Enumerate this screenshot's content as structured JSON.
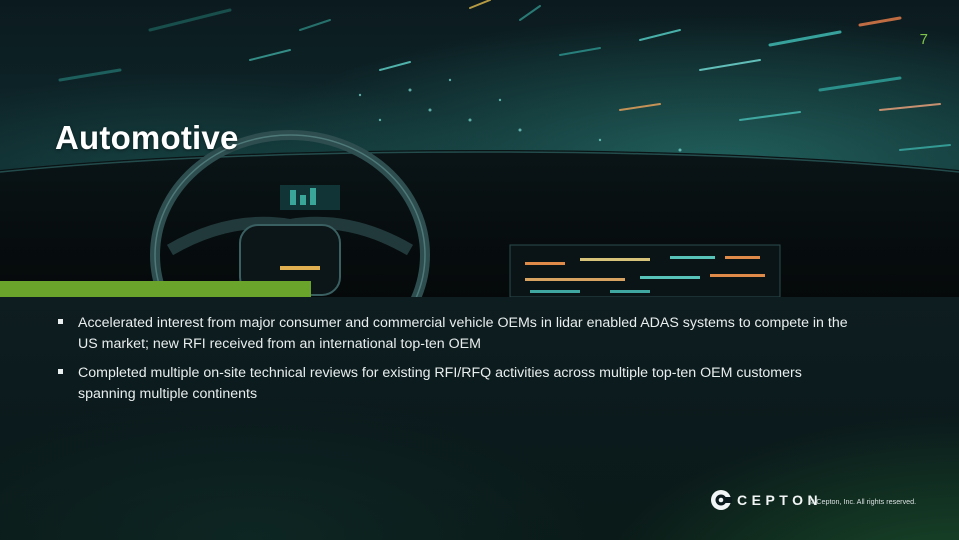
{
  "slide": {
    "page_number": "7",
    "title": "Automotive",
    "bullets": [
      "Accelerated interest from major consumer and commercial vehicle OEMs in lidar enabled ADAS systems to compete in the US market; new RFI received from an international top-ten OEM",
      "Completed multiple on-site technical reviews for existing RFI/RFQ activities across multiple top-ten OEM customers spanning multiple continents"
    ]
  },
  "footer": {
    "logo_text": "CEPTON",
    "copyright": "© Cepton, Inc. All rights reserved."
  },
  "colors": {
    "accent_green": "#6aa42a",
    "page_number": "#7fc34a",
    "text": "#e9eeee",
    "background": "#0b1518"
  },
  "icons": {
    "logo": "cepton-logo-icon"
  }
}
